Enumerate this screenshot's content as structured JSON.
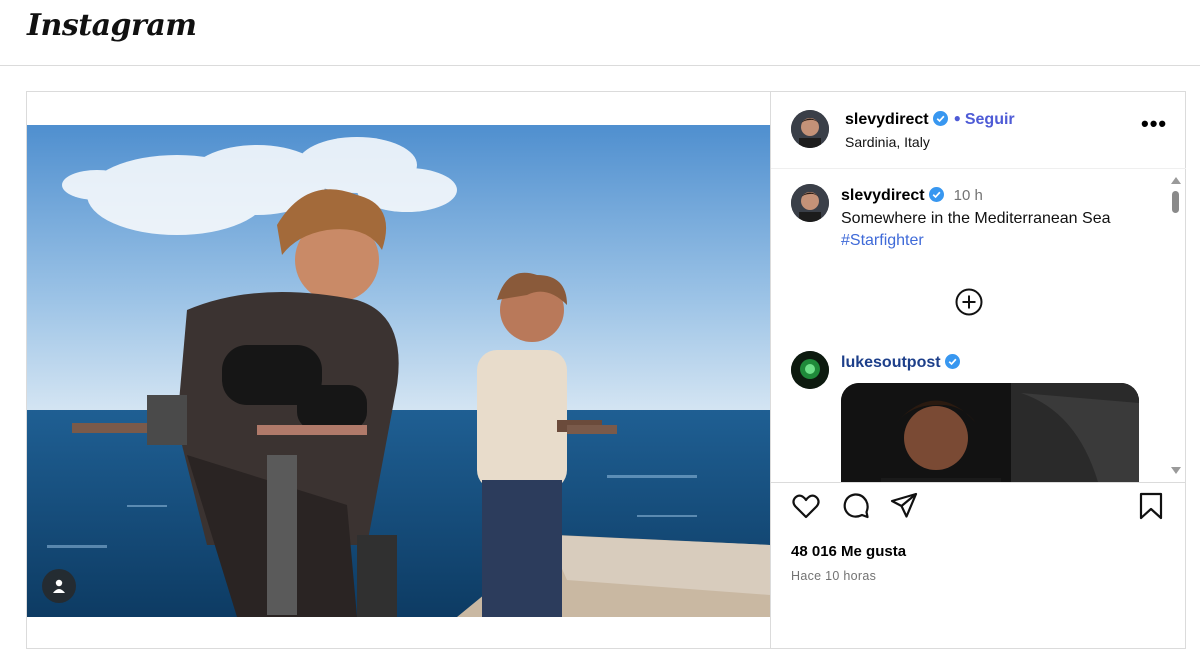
{
  "app": {
    "logo": "Instagram"
  },
  "post": {
    "author": {
      "username": "slevydirect",
      "follow_label": "Seguir",
      "location": "Sardinia, Italy"
    },
    "caption": {
      "username": "slevydirect",
      "time": "10 h",
      "text": "Somewhere in the Mediterranean Sea",
      "hashtag": "#Starfighter"
    },
    "reply": {
      "username": "lukesoutpost"
    },
    "likes": "48 016 Me gusta",
    "posted_ago": "Hace 10 horas"
  },
  "icons": {
    "like": "heart-icon",
    "comment": "comment-icon",
    "share": "share-icon",
    "save": "bookmark-icon",
    "more": "more-options-icon",
    "load_more": "plus-circle-icon",
    "tag_user": "user-tag-icon",
    "verified": "verified-badge-icon"
  },
  "colors": {
    "accent": "#4e5bd6",
    "hashtag": "#3f6ad8",
    "verified": "#3897f0",
    "border": "#dbdbdb",
    "muted": "#737373"
  }
}
